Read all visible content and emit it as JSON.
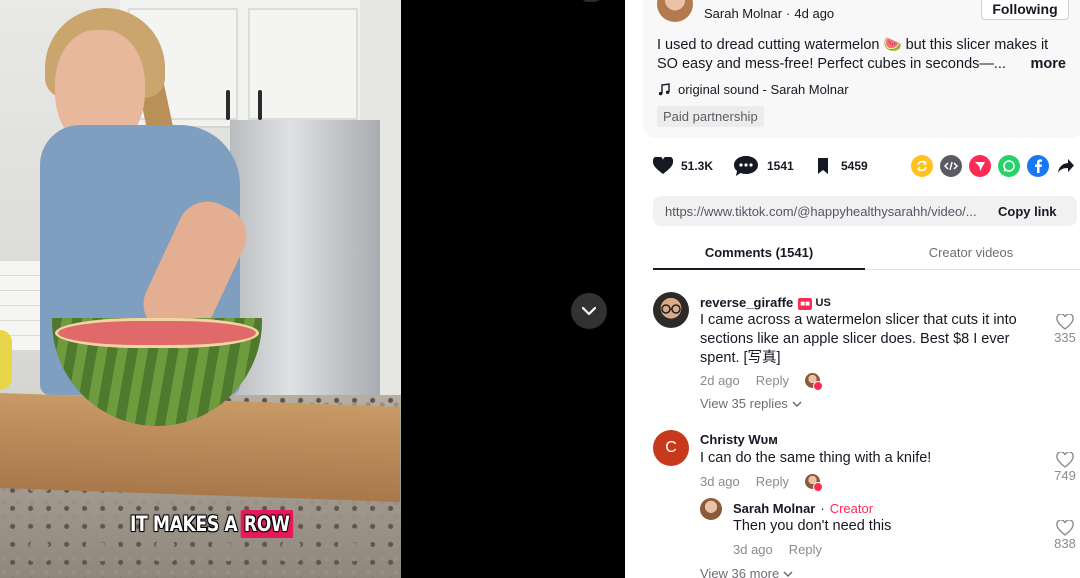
{
  "video": {
    "caption_plain": "IT MAKES A",
    "caption_highlight": "ROW"
  },
  "post": {
    "author_name": "Sarah Molnar",
    "posted": "4d ago",
    "follow_label": "Following",
    "description": "I used to dread cutting watermelon 🍉 but this slicer makes it SO easy and mess-free! Perfect cubes in seconds—...",
    "more_label": "more",
    "sound": "original sound - Sarah Molnar",
    "paid_tag": "Paid partnership"
  },
  "actions": {
    "likes": "51.3K",
    "comments": "1541",
    "saves": "5459"
  },
  "share_icons": [
    "repost-icon",
    "embed-icon",
    "send-icon",
    "whatsapp-icon",
    "facebook-icon",
    "share-arrow-icon"
  ],
  "link": {
    "url": "https://www.tiktok.com/@happyhealthysarahh/video/...",
    "copy_label": "Copy link"
  },
  "tabs": {
    "comments": "Comments (1541)",
    "creator_videos": "Creator videos"
  },
  "comments": [
    {
      "user": "reverse_giraffe",
      "region": "US",
      "text": "I came across a watermelon slicer that cuts it into sections like an apple slicer does. Best $8 I ever spent. [写真]",
      "time": "2d ago",
      "reply_label": "Reply",
      "likes": "335",
      "view_replies": "View 35 replies"
    },
    {
      "user": "Christy Wᴜᴍ",
      "avatar_letter": "C",
      "text": "I can do the same thing with a knife!",
      "time": "3d ago",
      "reply_label": "Reply",
      "likes": "749",
      "reply": {
        "user": "Sarah Molnar",
        "creator_tag": "Creator",
        "text": "Then you don't need this",
        "time": "3d ago",
        "reply_label": "Reply",
        "likes": "838"
      },
      "view_more": "View 36 more"
    }
  ],
  "colors": {
    "accent": "#fe2c55",
    "text": "#161823",
    "muted": "#8a8b91"
  }
}
